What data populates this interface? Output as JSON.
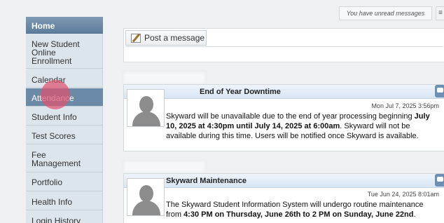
{
  "sidebar": {
    "items": [
      {
        "label": "Home"
      },
      {
        "label": "New Student Online Enrollment"
      },
      {
        "label": "Calendar"
      },
      {
        "label": "Attendance"
      },
      {
        "label": "Student Info"
      },
      {
        "label": "Test Scores"
      },
      {
        "label": "Fee Management"
      },
      {
        "label": "Portfolio"
      },
      {
        "label": "Health Info"
      },
      {
        "label": "Login History"
      }
    ],
    "active_item": "Attendance"
  },
  "header": {
    "unread_notice": "You have unread messages",
    "top_icon_glyph": "≡"
  },
  "post": {
    "tab_label": "Post a message",
    "input_value": ""
  },
  "messages": [
    {
      "title": "End of Year Downtime",
      "date": "Mon Jul 7, 2025 3:56pm",
      "body_1": "Skyward will be unavailable due to the end of year processing beginning ",
      "body_bold_1": "July 10, 2025 at 4:30pm until July 14, 2025 at 6:00am",
      "body_2": ". Skyward will not be available during this time. Users will be notified once Skyward is available."
    },
    {
      "title": "Skyward Maintenance",
      "date": "Tue Jun 24, 2025 8:01am",
      "body_1": "The Skyward Student Information System will undergo routine maintenance from ",
      "body_bold_1": "4:30 PM on Thursday, June 26th to 2 PM on Sunday, June 22nd",
      "body_2": "."
    }
  ],
  "colors": {
    "sidebar_bg": "#dde5ec",
    "home_header": "#6a89a6",
    "active_item": "#6b8aa8",
    "card_header": "#dde9f5",
    "click_marker": "#e0506e"
  }
}
